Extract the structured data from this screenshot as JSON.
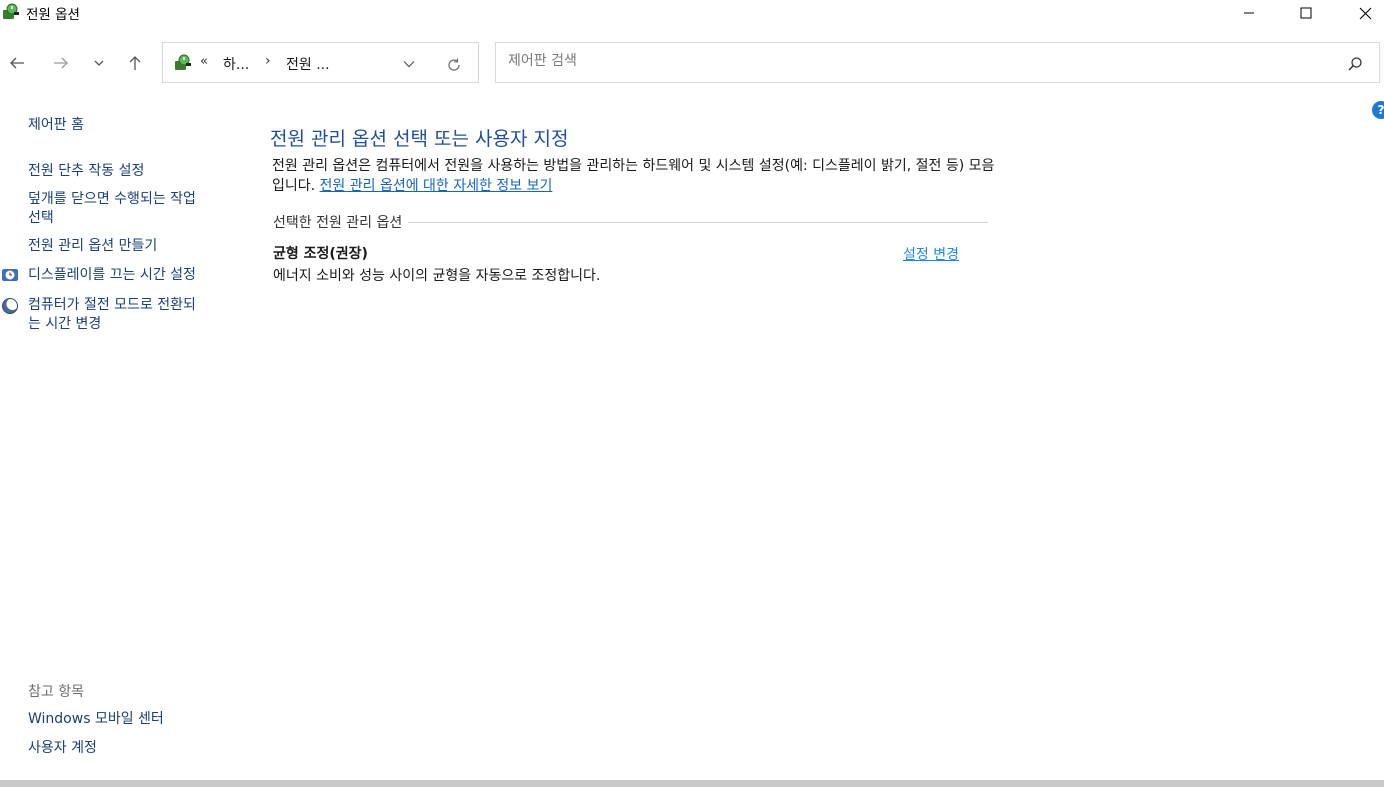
{
  "window": {
    "title": "전원 옵션",
    "icon": "power-options-icon"
  },
  "nav": {
    "back_icon": "arrow-left-icon",
    "forward_icon": "arrow-right-icon",
    "recent_icon": "chevron-down-icon",
    "up_icon": "arrow-up-icon"
  },
  "address": {
    "overflow": "«",
    "segment1": "하...",
    "separator": "›",
    "segment2": "전원 ...",
    "refresh_icon": "refresh-icon"
  },
  "search": {
    "placeholder": "제어판 검색",
    "value": ""
  },
  "sidebar": {
    "home": "제어판 홈",
    "items": [
      {
        "label": "전원 단추 작동 설정"
      },
      {
        "label": "덮개를 닫으면 수행되는 작업\n선택"
      },
      {
        "label": "전원 관리 옵션 만들기"
      },
      {
        "label": "디스플레이를 끄는 시간 설정",
        "icon": "display-timer-icon"
      },
      {
        "label": "컴퓨터가 절전 모드로 전환되\n는 시간 변경",
        "icon": "sleep-moon-icon"
      }
    ],
    "see_also_title": "참고 항목",
    "see_also": [
      {
        "label": "Windows 모바일 센터"
      },
      {
        "label": "사용자 계정"
      }
    ]
  },
  "main": {
    "heading": "전원 관리 옵션 선택 또는 사용자 지정",
    "description": "전원 관리 옵션은 컴퓨터에서 전원을 사용하는 방법을 관리하는 하드웨어 및 시스템 설정(예: 디스플레이 밝기, 절전 등) 모음입니다. ",
    "description_link": "전원 관리 옵션에 대한 자세한 정보 보기",
    "section_title": "선택한 전원 관리 옵션",
    "plan": {
      "name": "균형 조정(권장)",
      "description": "에너지 소비와 성능 사이의 균형을 자동으로 조정합니다.",
      "change_link": "설정 변경"
    }
  },
  "colors": {
    "heading": "#1e4e9c",
    "link": "#1565c0",
    "help": "#1e78d6"
  }
}
